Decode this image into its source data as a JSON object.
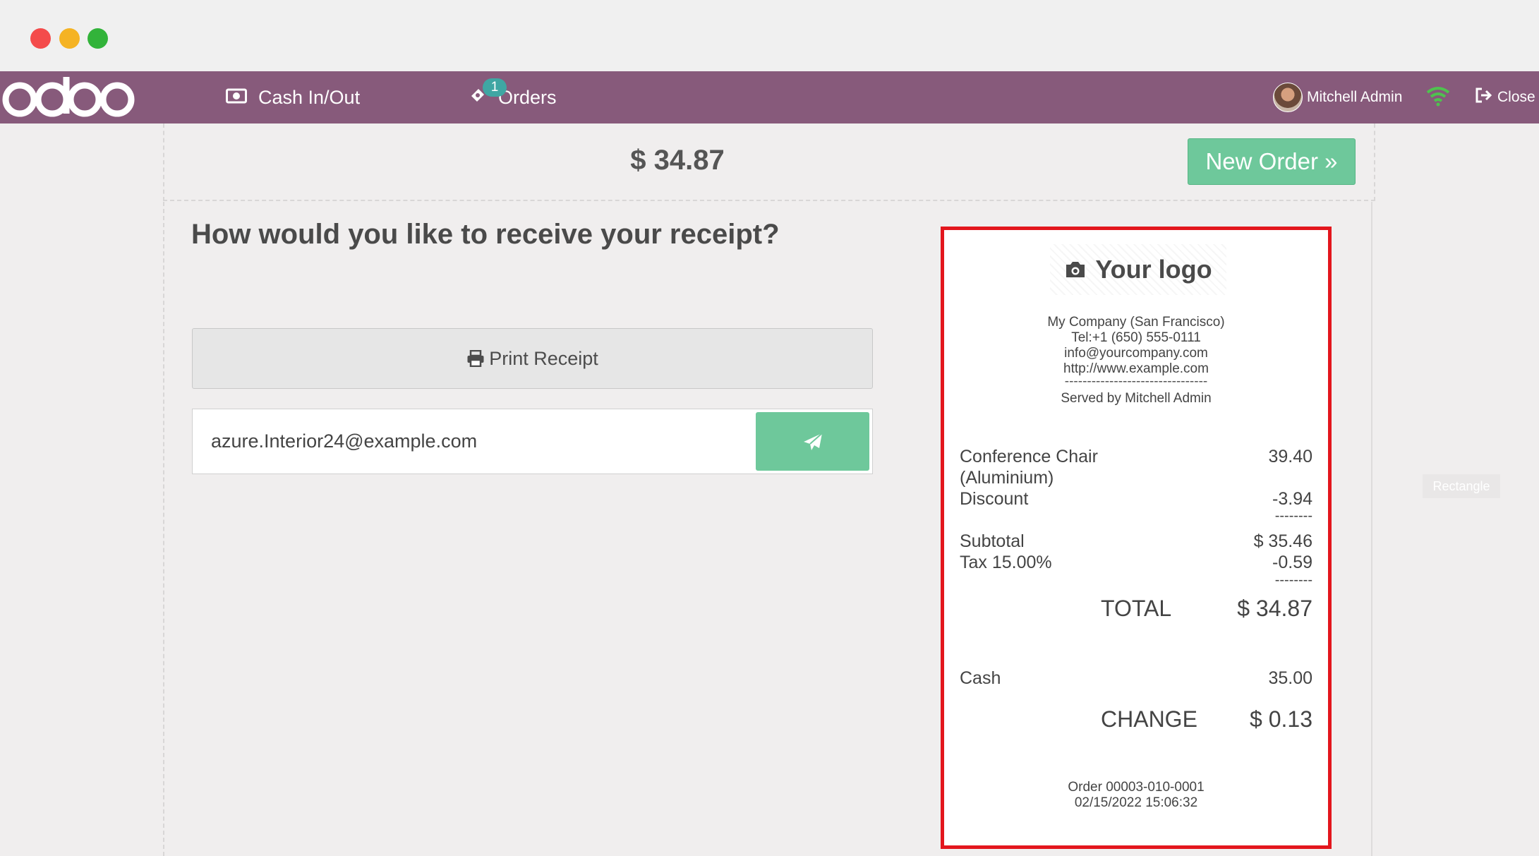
{
  "navbar": {
    "brand": "odoo",
    "cash_label": "Cash In/Out",
    "orders_label": "Orders",
    "orders_badge": "1",
    "user_name": "Mitchell Admin",
    "close_label": "Close"
  },
  "header": {
    "total": "$ 34.87",
    "new_order_label": "New Order »"
  },
  "main": {
    "question": "How would you like to receive your receipt?",
    "print_label": "Print Receipt",
    "email_value": "azure.Interior24@example.com"
  },
  "overlay_label": "Rectangle",
  "receipt": {
    "logo_text": "Your logo",
    "company": [
      "My Company (San Francisco)",
      "Tel:+1 (650) 555-0111",
      "info@yourcompany.com",
      "http://www.example.com"
    ],
    "separator": "--------------------------------",
    "served_by": "Served by Mitchell Admin",
    "line_item_1": "Conference Chair",
    "line_item_2": "(Aluminium)",
    "line_price": "39.40",
    "discount_label": "Discount",
    "discount_value": "-3.94",
    "dashes": "--------",
    "subtotal_label": "Subtotal",
    "subtotal_value": "$ 35.46",
    "tax_label": "Tax 15.00%",
    "tax_value": "-0.59",
    "total_label": "TOTAL",
    "total_value": "$ 34.87",
    "cash_label": "Cash",
    "cash_value": "35.00",
    "change_label": "CHANGE",
    "change_value": "$ 0.13",
    "order_ref": "Order 00003-010-0001",
    "order_date": "02/15/2022 15:06:32"
  },
  "colors": {
    "navbar": "#875a7b",
    "accent_green": "#6ec89b",
    "highlight": "#e3161d",
    "badge": "#3fa6a3"
  }
}
